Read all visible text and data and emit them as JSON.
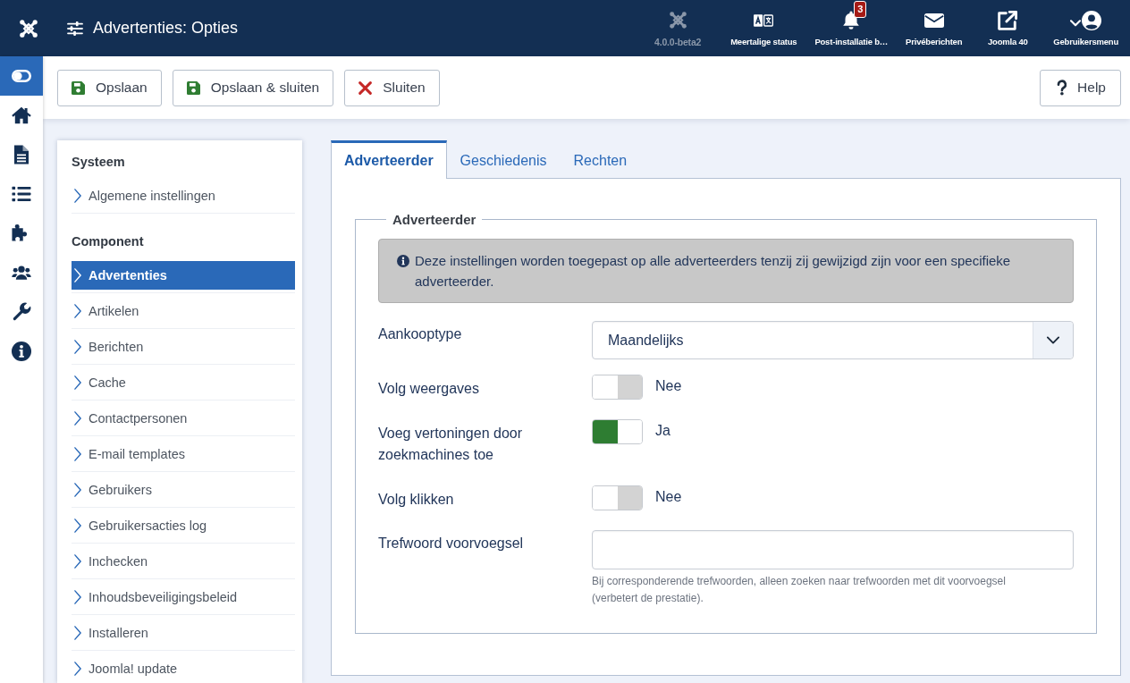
{
  "top_bar": {
    "title": "Advertenties: Opties",
    "items": [
      {
        "kind": "version",
        "label": "4.0.0-beta2"
      },
      {
        "kind": "language",
        "label": "Meertalige status"
      },
      {
        "kind": "notifications",
        "label": "Post-installatie b…",
        "badge": "3"
      },
      {
        "kind": "messages",
        "label": "Privéberichten"
      },
      {
        "kind": "site",
        "label": "Joomla 40"
      },
      {
        "kind": "user",
        "label": "Gebruikersmenu"
      }
    ]
  },
  "rail": {
    "items": [
      {
        "kind": "toggle",
        "selected": true
      },
      {
        "kind": "home",
        "selected": false
      },
      {
        "kind": "content",
        "selected": false
      },
      {
        "kind": "menus",
        "selected": false
      },
      {
        "kind": "extensions",
        "selected": false
      },
      {
        "kind": "users",
        "selected": false
      },
      {
        "kind": "system",
        "selected": false
      },
      {
        "kind": "help",
        "selected": false
      }
    ]
  },
  "toolbar": {
    "buttons": [
      {
        "kind": "save",
        "label": "Opslaan"
      },
      {
        "kind": "save",
        "label": "Opslaan & sluiten"
      },
      {
        "kind": "close",
        "label": "Sluiten"
      }
    ],
    "help": {
      "label": "Help"
    }
  },
  "components": {
    "sections": [
      {
        "heading": "Systeem",
        "items": [
          {
            "label": "Algemene instellingen",
            "selected": false
          }
        ]
      },
      {
        "heading": "Component",
        "items": [
          {
            "label": "Advertenties",
            "selected": true
          },
          {
            "label": "Artikelen",
            "selected": false
          },
          {
            "label": "Berichten",
            "selected": false
          },
          {
            "label": "Cache",
            "selected": false
          },
          {
            "label": "Contactpersonen",
            "selected": false
          },
          {
            "label": "E-mail templates",
            "selected": false
          },
          {
            "label": "Gebruikers",
            "selected": false
          },
          {
            "label": "Gebruikersacties log",
            "selected": false
          },
          {
            "label": "Inchecken",
            "selected": false
          },
          {
            "label": "Inhoudsbeveiligingsbeleid",
            "selected": false
          },
          {
            "label": "Installeren",
            "selected": false
          },
          {
            "label": "Joomla! update",
            "selected": false
          }
        ]
      }
    ]
  },
  "tabs": [
    {
      "label": "Adverteerder",
      "selected": true
    },
    {
      "label": "Geschiedenis",
      "selected": false
    },
    {
      "label": "Rechten",
      "selected": false
    }
  ],
  "fieldset": {
    "legend": "Adverteerder",
    "alert": "Deze instellingen worden toegepast op alle adverteerders tenzij zij gewijzigd zijn voor een specifieke adverteerder.",
    "fields": [
      {
        "kind": "select",
        "label": "Aankooptype",
        "value": "Maandelijks"
      },
      {
        "kind": "toggle",
        "label": "Volg weergaves",
        "on": false,
        "value": "Nee"
      },
      {
        "kind": "toggle",
        "label": "Voeg vertoningen door zoekmachines toe",
        "on": true,
        "value": "Ja"
      },
      {
        "kind": "toggle",
        "label": "Volg klikken",
        "on": false,
        "value": "Nee"
      },
      {
        "kind": "text",
        "label": "Trefwoord voorvoegsel",
        "help": "Bij corresponderende trefwoorden, alleen zoeken naar trefwoorden met dit voorvoegsel (verbetert de prestatie)."
      }
    ]
  }
}
